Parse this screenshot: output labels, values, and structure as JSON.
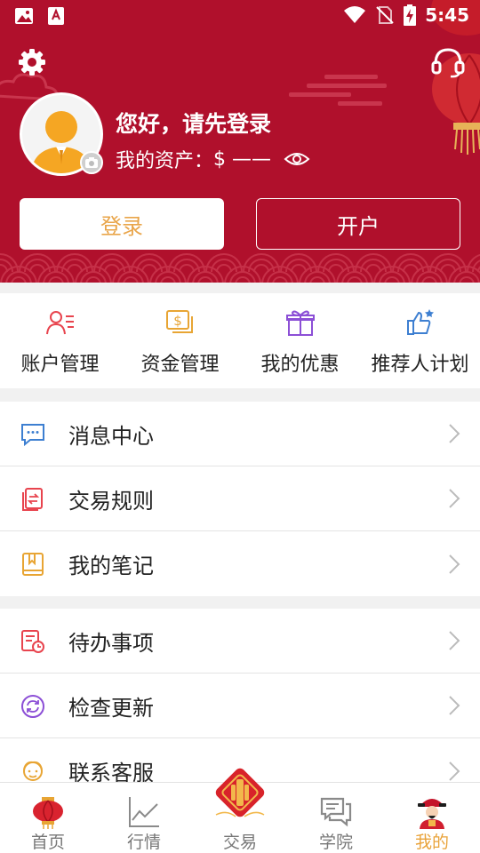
{
  "status_bar": {
    "time": "5:45"
  },
  "header": {
    "greeting": "您好，请先登录",
    "assets_label": "我的资产：",
    "assets_value": "$ ——",
    "login_button": "登录",
    "open_account_button": "开户"
  },
  "quick_actions": [
    {
      "label": "账户管理",
      "icon": "account-icon"
    },
    {
      "label": "资金管理",
      "icon": "funds-icon"
    },
    {
      "label": "我的优惠",
      "icon": "gift-icon"
    },
    {
      "label": "推荐人计划",
      "icon": "thumbs-up-icon"
    }
  ],
  "menu_group_1": [
    {
      "label": "消息中心",
      "icon": "message-icon"
    },
    {
      "label": "交易规则",
      "icon": "rules-icon"
    },
    {
      "label": "我的笔记",
      "icon": "notebook-icon"
    }
  ],
  "menu_group_2": [
    {
      "label": "待办事项",
      "icon": "todo-icon"
    },
    {
      "label": "检查更新",
      "icon": "update-icon"
    },
    {
      "label": "联系客服",
      "icon": "customer-service-icon"
    }
  ],
  "bottom_nav": [
    {
      "label": "首页",
      "icon": "lantern-icon",
      "active": false
    },
    {
      "label": "行情",
      "icon": "chart-icon",
      "active": false
    },
    {
      "label": "交易",
      "icon": "firecracker-icon",
      "active": false
    },
    {
      "label": "学院",
      "icon": "chat-icon",
      "active": false
    },
    {
      "label": "我的",
      "icon": "god-of-wealth-icon",
      "active": true
    }
  ],
  "colors": {
    "header_bg": "#b0102c",
    "accent_gold": "#e9a33a",
    "icon_red": "#e8444e",
    "icon_blue": "#3d7fd1",
    "icon_purple": "#8c4fd6",
    "icon_gold": "#e8a534"
  }
}
